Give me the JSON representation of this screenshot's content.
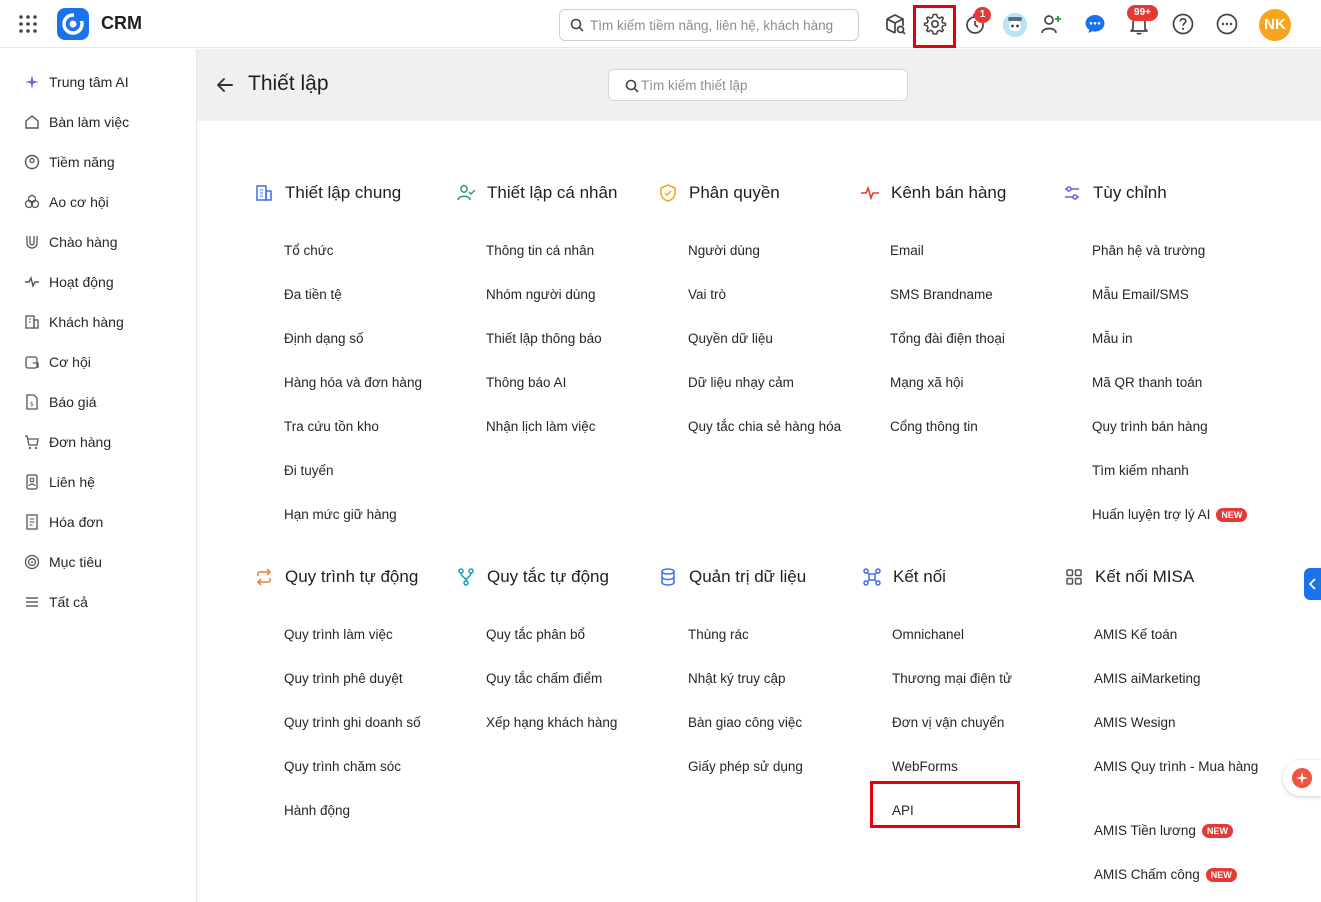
{
  "topbar": {
    "app_name": "CRM",
    "search_placeholder": "Tìm kiếm tiềm năng, liên hệ, khách hàng",
    "timer_badge": "1",
    "notification_badge": "99+",
    "user_initials": "NK"
  },
  "sidebar": {
    "items": [
      {
        "label": "Trung tâm AI",
        "icon": "sparkle-icon"
      },
      {
        "label": "Bàn làm việc",
        "icon": "home-icon"
      },
      {
        "label": "Tiềm năng",
        "icon": "target-user-icon"
      },
      {
        "label": "Ao cơ hội",
        "icon": "pool-icon"
      },
      {
        "label": "Chào hàng",
        "icon": "magnet-icon"
      },
      {
        "label": "Hoạt động",
        "icon": "activity-icon"
      },
      {
        "label": "Khách hàng",
        "icon": "building-icon"
      },
      {
        "label": "Cơ hội",
        "icon": "opportunity-icon"
      },
      {
        "label": "Báo giá",
        "icon": "quote-icon"
      },
      {
        "label": "Đơn hàng",
        "icon": "cart-icon"
      },
      {
        "label": "Liên hệ",
        "icon": "contact-icon"
      },
      {
        "label": "Hóa đơn",
        "icon": "invoice-icon"
      },
      {
        "label": "Mục tiêu",
        "icon": "goal-icon"
      },
      {
        "label": "Tất cả",
        "icon": "menu-icon"
      }
    ]
  },
  "page": {
    "title": "Thiết lập",
    "search_placeholder": "Tìm kiếm thiết lập"
  },
  "sections": [
    {
      "title": "Thiết lập chung",
      "icon": "building-icon",
      "items": [
        "Tổ chức",
        "Đa tiền tệ",
        "Định dạng số",
        "Hàng hóa và đơn hàng",
        "Tra cứu tồn kho",
        "Đi tuyến",
        "Hạn mức giữ hàng"
      ]
    },
    {
      "title": "Thiết lập cá nhân",
      "icon": "user-check-icon",
      "items": [
        "Thông tin cá nhân",
        "Nhóm người dùng",
        "Thiết lập thông báo",
        "Thông báo AI",
        "Nhận lịch làm việc"
      ]
    },
    {
      "title": "Phân quyền",
      "icon": "shield-icon",
      "items": [
        "Người dùng",
        "Vai trò",
        "Quyền dữ liệu",
        "Dữ liệu nhạy cảm",
        "Quy tắc chia sẻ hàng hóa"
      ]
    },
    {
      "title": "Kênh bán hàng",
      "icon": "pulse-icon",
      "items": [
        "Email",
        "SMS Brandname",
        "Tổng đài điện thoại",
        "Mạng xã hội",
        "Cổng thông tin"
      ]
    },
    {
      "title": "Tùy chỉnh",
      "icon": "sliders-icon",
      "items": [
        "Phân hệ và trường",
        "Mẫu Email/SMS",
        "Mẫu in",
        "Mã QR thanh toán",
        "Quy trình bán hàng",
        "Tìm kiếm nhanh",
        "Huấn luyện trợ lý AI"
      ],
      "new_items": [
        6
      ]
    },
    {
      "title": "Quy trình tự động",
      "icon": "repeat-icon",
      "items": [
        "Quy trình làm việc",
        "Quy trình phê duyệt",
        "Quy trình ghi doanh số",
        "Quy trình chăm sóc",
        "Hành động"
      ]
    },
    {
      "title": "Quy tắc tự động",
      "icon": "branch-icon",
      "items": [
        "Quy tắc phân bổ",
        "Quy tắc chấm điểm",
        "Xếp hạng khách hàng"
      ]
    },
    {
      "title": "Quản trị dữ liệu",
      "icon": "database-icon",
      "items": [
        "Thùng rác",
        "Nhật ký truy cập",
        "Bàn giao công việc",
        "Giấy phép sử dụng"
      ]
    },
    {
      "title": "Kết nối",
      "icon": "connect-icon",
      "items": [
        "Omnichanel",
        "Thương mại điện tử",
        "Đơn vị vận chuyển",
        "WebForms",
        "API"
      ]
    },
    {
      "title": "Kết nối MISA",
      "icon": "grid-icon",
      "items": [
        "AMIS Kế toán",
        "AMIS aiMarketing",
        "AMIS Wesign",
        "AMIS Quy trình - Mua hàng",
        "AMIS Tiền lương",
        "AMIS Chấm công"
      ],
      "new_items": [
        4,
        5
      ]
    }
  ],
  "new_label": "NEW",
  "colors": {
    "accent": "#1a73e8",
    "highlight": "#e3000f",
    "badge": "#e53935",
    "avatar": "#f7a51c"
  }
}
